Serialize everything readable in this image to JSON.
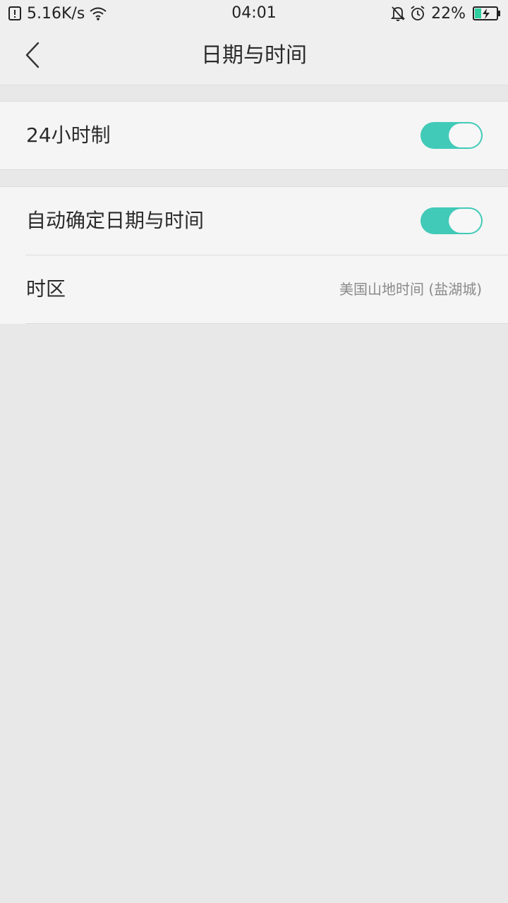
{
  "status_bar": {
    "network_speed": "5.16K/s",
    "time": "04:01",
    "battery_percent": "22%",
    "battery_level": 0.22,
    "battery_color": "#2ecfa0",
    "icons": [
      "sim-alert-icon",
      "wifi-icon",
      "bell-off-icon",
      "alarm-icon",
      "battery-charging-icon"
    ]
  },
  "header": {
    "title": "日期与时间",
    "back_icon": "chevron-left-icon"
  },
  "settings": {
    "hour24": {
      "label": "24小时制",
      "enabled": true
    },
    "auto_datetime": {
      "label": "自动确定日期与时间",
      "enabled": true
    },
    "timezone": {
      "label": "时区",
      "value": "美国山地时间 (盐湖城)"
    }
  },
  "colors": {
    "accent": "#41cab8",
    "background": "#e8e8e8",
    "card": "#f5f5f5"
  }
}
